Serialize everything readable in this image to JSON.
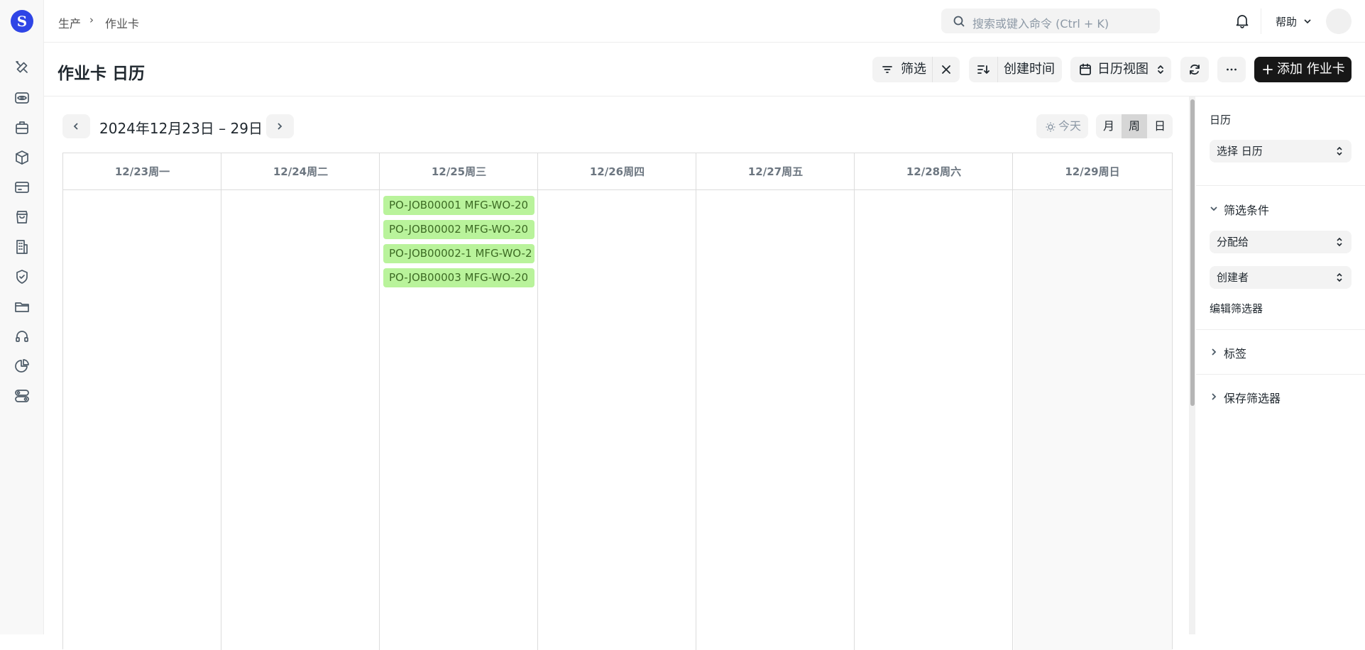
{
  "breadcrumb": {
    "module": "生产",
    "doctype": "作业卡"
  },
  "search": {
    "placeholder": "搜索或键入命令 (Ctrl + K)"
  },
  "navbar": {
    "help_label": "帮助"
  },
  "page": {
    "title": "作业卡 日历"
  },
  "toolbar": {
    "filter_label": "筛选",
    "sort_label": "创建时间",
    "view_label": "日历视图",
    "add_label": "添加 作业卡"
  },
  "calendar": {
    "range_label": "2024年12月23日 – 29日",
    "today_label": "今天",
    "view_modes": [
      "月",
      "周",
      "日"
    ],
    "active_view": "周",
    "days": [
      "12/23周一",
      "12/24周二",
      "12/25周三",
      "12/26周四",
      "12/27周五",
      "12/28周六",
      "12/29周日"
    ],
    "events": [
      {
        "label": "PO-JOB00001 MFG-WO-20",
        "day": "12/25周三"
      },
      {
        "label": "PO-JOB00002 MFG-WO-20",
        "day": "12/25周三"
      },
      {
        "label": "PO-JOB00002-1 MFG-WO-2",
        "day": "12/25周三"
      },
      {
        "label": "PO-JOB00003 MFG-WO-20",
        "day": "12/25周三"
      }
    ],
    "event_color": "#b9f39b"
  },
  "sidebar_right": {
    "calendar_label": "日历",
    "calendar_select": "选择 日历",
    "filters_title": "筛选条件",
    "assigned_to": "分配给",
    "created_by": "创建者",
    "edit_filters": "编辑筛选器",
    "tags_title": "标签",
    "saved_filters_title": "保存筛选器"
  },
  "sidebar_left": {
    "icons": [
      "tools-icon",
      "eye-icon",
      "briefcase-icon",
      "box-icon",
      "card-icon",
      "shopping-bag-icon",
      "building-icon",
      "shield-check-icon",
      "folder-icon",
      "headset-icon",
      "pie-chart-icon",
      "toggles-icon"
    ]
  },
  "colors": {
    "primary_button": "#171717",
    "logo": "#2f45e6"
  }
}
